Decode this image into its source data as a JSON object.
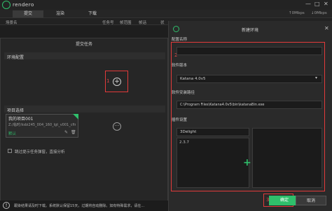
{
  "app": {
    "name": "rendero"
  },
  "window_controls": [
    "—",
    "□",
    "✕"
  ],
  "tabs": [
    {
      "label": "提交",
      "active": true
    },
    {
      "label": "渲染",
      "active": false
    },
    {
      "label": "下载",
      "active": false
    }
  ],
  "speed": {
    "up": "↑0Mbps",
    "down": "↓0Mbps"
  },
  "table_headers": [
    "场景名",
    "任务号",
    "帧范围",
    "帧话",
    "状"
  ],
  "submit_dialog": {
    "title": "提交任务",
    "env_section": "环境配置",
    "project_section": "项目选择",
    "annotation_1": "1",
    "project": {
      "name": "我的项目001",
      "path": "Z:/临时/ksbi245_004_160_lgt_v001_cfir_...",
      "tag": "默认"
    },
    "skip_option": "跳过提示任务弹窗，直接分析"
  },
  "status_bar": {
    "text": "跟染结果请及时下载。系统默认保留15天，过期将自动删除。如有特殊需求，请在..."
  },
  "env_dialog": {
    "title": "新建环境",
    "annotation_2": "2",
    "annotation_3": "3",
    "config_name_label": "配置名称",
    "config_name_value": "",
    "software_label": "软件版本",
    "software_value": "Katana 4.0v5",
    "install_path_label": "软件安装路径",
    "install_path_value": "C:\\Program Files\\Katana4.0v5\\bin\\katanaBin.exe",
    "plugin_label": "插件设置",
    "plugin_value": "3Delight",
    "plugin_version": "2.3.7",
    "ok_label": "确定",
    "cancel_label": "取消"
  },
  "colors": {
    "accent": "#2fbf6b",
    "annotation": "#e23a3a"
  }
}
